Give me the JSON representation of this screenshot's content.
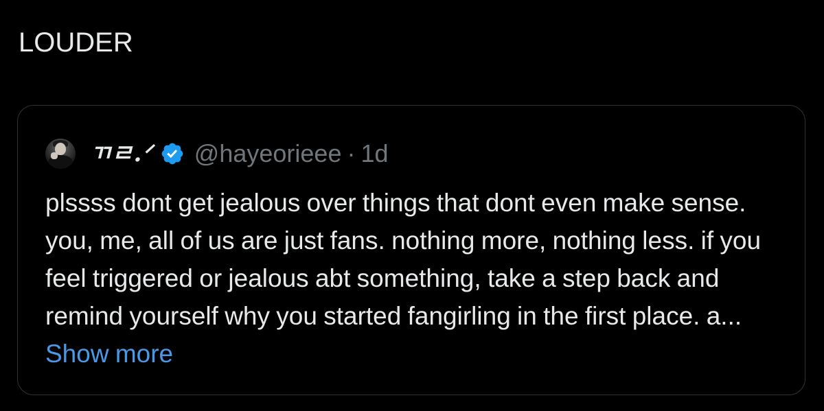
{
  "post": {
    "text": "LOUDER"
  },
  "quote": {
    "author": {
      "display_name": "ㄲㄹ.ᐟ",
      "handle": "@hayeorieee",
      "separator": "·",
      "time": "1d",
      "verified": true,
      "avatar_icon": "user-avatar"
    },
    "body_text": "plssss dont get jealous over things that dont even make sense. you, me, all of us are just fans. nothing more, nothing less. if you feel triggered or jealous abt something, take a step back and remind yourself why you started fangirling in the first place. a...",
    "show_more_label": "Show more"
  },
  "colors": {
    "background": "#000000",
    "text_primary": "#e7e9ea",
    "text_secondary": "#71767b",
    "link_accent": "#4a99e9",
    "border": "#2f3336",
    "verified_badge": "#1d9bf0"
  }
}
